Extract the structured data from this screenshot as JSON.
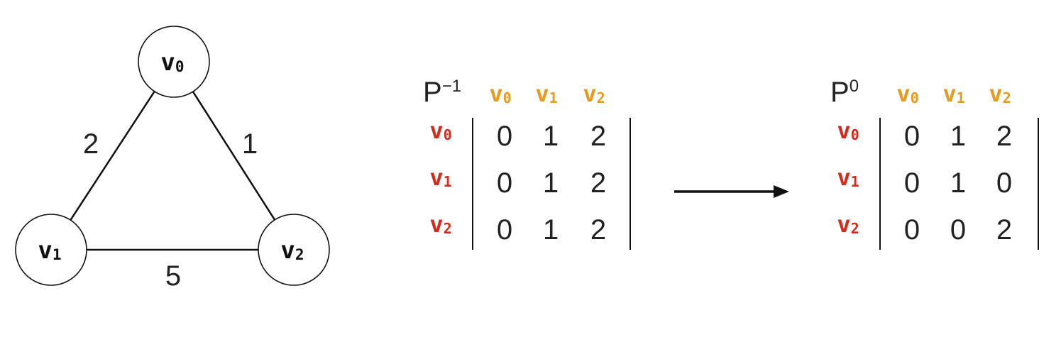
{
  "colors": {
    "column_header": "#e89a1c",
    "row_header": "#d42b1c",
    "stroke": "#111111",
    "text": "#222222"
  },
  "graph": {
    "nodes": [
      {
        "id": "v0",
        "base": "v",
        "sub": "0"
      },
      {
        "id": "v1",
        "base": "v",
        "sub": "1"
      },
      {
        "id": "v2",
        "base": "v",
        "sub": "2"
      }
    ],
    "edges": [
      {
        "from": "v0",
        "to": "v1",
        "weight": "2"
      },
      {
        "from": "v0",
        "to": "v2",
        "weight": "1"
      },
      {
        "from": "v1",
        "to": "v2",
        "weight": "5"
      }
    ]
  },
  "matrices": [
    {
      "id": "P-1",
      "name_base": "P",
      "name_sup": "−1",
      "col_headers": [
        {
          "base": "v",
          "sub": "0"
        },
        {
          "base": "v",
          "sub": "1"
        },
        {
          "base": "v",
          "sub": "2"
        }
      ],
      "row_headers": [
        {
          "base": "v",
          "sub": "0"
        },
        {
          "base": "v",
          "sub": "1"
        },
        {
          "base": "v",
          "sub": "2"
        }
      ],
      "values": [
        [
          "0",
          "1",
          "2"
        ],
        [
          "0",
          "1",
          "2"
        ],
        [
          "0",
          "1",
          "2"
        ]
      ]
    },
    {
      "id": "P0",
      "name_base": "P",
      "name_sup": "0",
      "col_headers": [
        {
          "base": "v",
          "sub": "0"
        },
        {
          "base": "v",
          "sub": "1"
        },
        {
          "base": "v",
          "sub": "2"
        }
      ],
      "row_headers": [
        {
          "base": "v",
          "sub": "0"
        },
        {
          "base": "v",
          "sub": "1"
        },
        {
          "base": "v",
          "sub": "2"
        }
      ],
      "values": [
        [
          "0",
          "1",
          "2"
        ],
        [
          "0",
          "1",
          "0"
        ],
        [
          "0",
          "0",
          "2"
        ]
      ]
    }
  ],
  "arrow": {
    "icon": "right-arrow-icon"
  }
}
